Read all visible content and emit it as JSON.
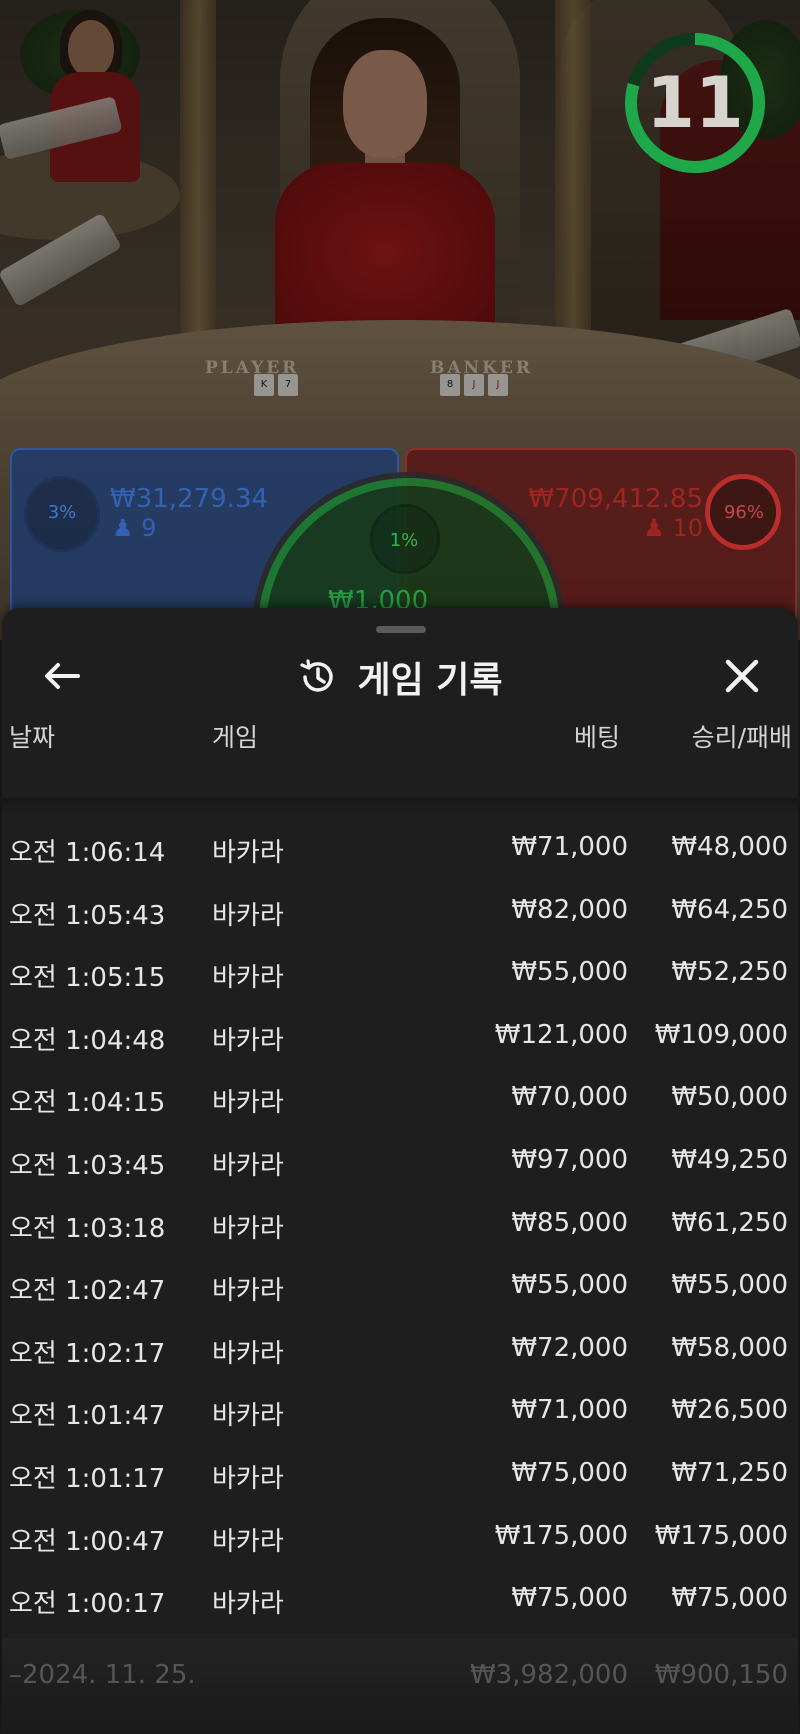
{
  "timer": {
    "seconds": "11"
  },
  "table": {
    "player_label": "PLAYER",
    "banker_label": "BANKER"
  },
  "bets": {
    "player": {
      "percent": "3%",
      "amount": "₩31,279.34",
      "players": "9"
    },
    "tie": {
      "percent": "1%",
      "amount": "₩1,000"
    },
    "banker": {
      "percent": "96%",
      "amount": "₩709,412.85",
      "players": "10"
    }
  },
  "sheet": {
    "title": "게임 기록",
    "columns": {
      "date": "날짜",
      "game": "게임",
      "bet": "베팅",
      "winloss": "승리/패배"
    },
    "rows": [
      {
        "time": "오전 1:06:14",
        "game": "바카라",
        "bet": "₩71,000",
        "result": "₩48,000"
      },
      {
        "time": "오전 1:05:43",
        "game": "바카라",
        "bet": "₩82,000",
        "result": "₩64,250"
      },
      {
        "time": "오전 1:05:15",
        "game": "바카라",
        "bet": "₩55,000",
        "result": "₩52,250"
      },
      {
        "time": "오전 1:04:48",
        "game": "바카라",
        "bet": "₩121,000",
        "result": "₩109,000"
      },
      {
        "time": "오전 1:04:15",
        "game": "바카라",
        "bet": "₩70,000",
        "result": "₩50,000"
      },
      {
        "time": "오전 1:03:45",
        "game": "바카라",
        "bet": "₩97,000",
        "result": "₩49,250"
      },
      {
        "time": "오전 1:03:18",
        "game": "바카라",
        "bet": "₩85,000",
        "result": "₩61,250"
      },
      {
        "time": "오전 1:02:47",
        "game": "바카라",
        "bet": "₩55,000",
        "result": "₩55,000"
      },
      {
        "time": "오전 1:02:17",
        "game": "바카라",
        "bet": "₩72,000",
        "result": "₩58,000"
      },
      {
        "time": "오전 1:01:47",
        "game": "바카라",
        "bet": "₩71,000",
        "result": "₩26,500"
      },
      {
        "time": "오전 1:01:17",
        "game": "바카라",
        "bet": "₩75,000",
        "result": "₩71,250"
      },
      {
        "time": "오전 1:00:47",
        "game": "바카라",
        "bet": "₩175,000",
        "result": "₩175,000"
      },
      {
        "time": "오전 1:00:17",
        "game": "바카라",
        "bet": "₩75,000",
        "result": "₩75,000"
      }
    ],
    "summary": {
      "date": "–2024. 11. 25.",
      "bet_total": "₩3,982,000",
      "result_total": "₩900,150"
    }
  },
  "colors": {
    "player": "#2e6ad1",
    "banker": "#d32a2a",
    "tie": "#23a83a",
    "timer": "#1fa84a"
  },
  "icons": [
    "back-arrow-icon",
    "history-icon",
    "close-icon",
    "person-icon"
  ]
}
